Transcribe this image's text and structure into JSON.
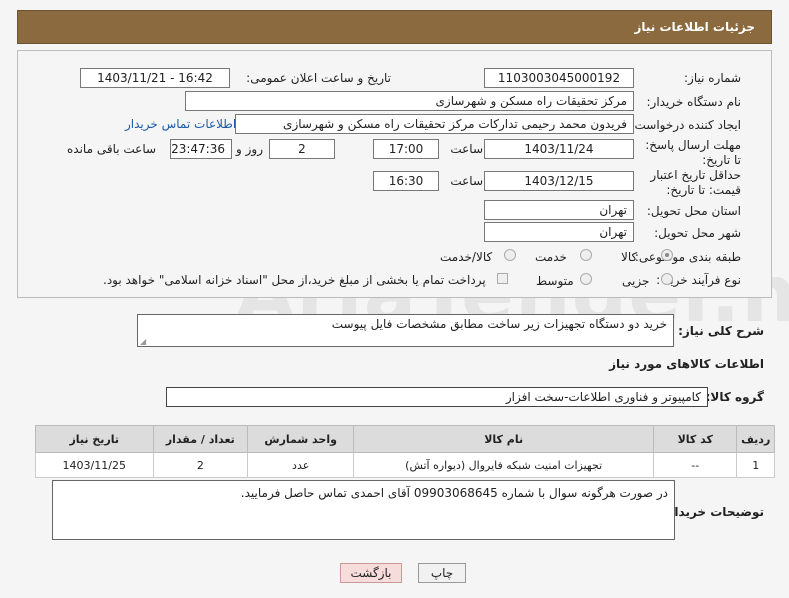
{
  "header": {
    "title": "جزئیات اطلاعات نیاز"
  },
  "form": {
    "need_number_label": "شماره نیاز:",
    "need_number": "1103003045000192",
    "announce_label": "تاریخ و ساعت اعلان عمومی:",
    "announce_value": "1403/11/21 - 16:42",
    "buyer_org_label": "نام دستگاه خریدار:",
    "buyer_org": "مرکز تحقیقات راه  مسکن و شهرسازی",
    "creator_label": "ایجاد کننده درخواست:",
    "creator": "فریدون محمد رحیمی تدارکات مرکز تحقیقات راه  مسکن و شهرسازی",
    "contact_link": "اطلاعات تماس خریدار",
    "deadline_label": "مهلت ارسال پاسخ: تا تاریخ:",
    "deadline_date": "1403/11/24",
    "deadline_time_label": "ساعت",
    "deadline_time": "17:00",
    "days": "2",
    "days_label": "روز و",
    "remaining": "23:47:36",
    "remaining_label": "ساعت باقی مانده",
    "validity_label": "حداقل تاریخ اعتبار قیمت: تا تاریخ:",
    "validity_date": "1403/12/15",
    "validity_time_label": "ساعت",
    "validity_time": "16:30",
    "province_label": "استان محل تحویل:",
    "province": "تهران",
    "city_label": "شهر محل تحویل:",
    "city": "تهران",
    "category_label": "طبقه بندی موضوعی:",
    "category_options": [
      "کالا",
      "خدمت",
      "کالا/خدمت"
    ],
    "process_label": "نوع فرآیند خرید :",
    "process_options": [
      "جزیی",
      "متوسط"
    ],
    "payment_note": "پرداخت تمام یا بخشی از مبلغ خرید،از محل \"اسناد خزانه اسلامی\" خواهد بود."
  },
  "description": {
    "label": "شرح کلی نیاز:",
    "value": "خرید دو دستگاه تجهیزات زیر ساخت مطابق مشخصات فایل پیوست"
  },
  "goods_info_title": "اطلاعات کالاهای مورد نیاز",
  "goods_group": {
    "label": "گروه کالا:",
    "value": "کامپیوتر و فناوری اطلاعات-سخت افزار"
  },
  "table": {
    "headers": [
      "ردیف",
      "کد کالا",
      "نام کالا",
      "واحد شمارش",
      "تعداد / مقدار",
      "تاریخ نیاز"
    ],
    "rows": [
      [
        "1",
        "--",
        "تجهیزات امنیت شبکه فایروال (دیواره آتش)",
        "عدد",
        "2",
        "1403/11/25"
      ]
    ]
  },
  "buyer_notes": {
    "label": "توضیحات خریدار:",
    "value": "در صورت هرگونه سوال با شماره  09903068645 آقای احمدی تماس حاصل فرمایید."
  },
  "buttons": {
    "print": "چاپ",
    "back": "بازگشت"
  },
  "watermark": "AriaTender.net"
}
